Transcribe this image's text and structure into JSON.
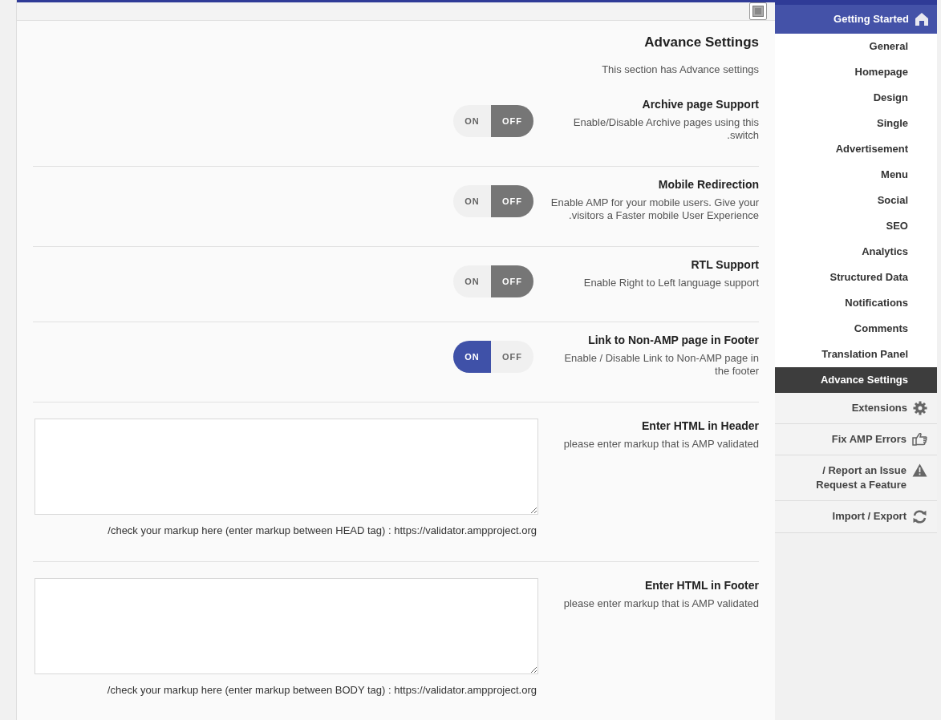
{
  "section": {
    "title": "Advance Settings",
    "description": "This section has Advance settings"
  },
  "settings": [
    {
      "kind": "toggle",
      "title": "Archive page Support",
      "description": "Enable/Disable Archive pages using this\n.switch",
      "on_label": "ON",
      "off_label": "OFF",
      "on": false
    },
    {
      "kind": "toggle",
      "title": "Mobile Redirection",
      "description": "Enable AMP for your mobile users. Give your\n.visitors a Faster mobile User Experience",
      "on_label": "ON",
      "off_label": "OFF",
      "on": false
    },
    {
      "kind": "toggle",
      "title": "RTL Support",
      "description": "Enable Right to Left language support",
      "on_label": "ON",
      "off_label": "OFF",
      "on": false
    },
    {
      "kind": "toggle",
      "title": "Link to Non-AMP page in Footer",
      "description": "Enable / Disable Link to Non-AMP page in\nthe footer",
      "on_label": "ON",
      "off_label": "OFF",
      "on": true
    },
    {
      "kind": "textarea",
      "title": "Enter HTML in Header",
      "description": "please enter markup that is AMP validated",
      "note": "/check your markup here (enter markup between HEAD tag) : https://validator.ampproject.org"
    },
    {
      "kind": "textarea",
      "title": "Enter HTML in Footer",
      "description": "please enter markup that is AMP validated",
      "note": "/check your markup here (enter markup between BODY tag) : https://validator.ampproject.org"
    }
  ],
  "sidebar": {
    "header": "Getting Started",
    "items": [
      {
        "label": "General",
        "selected": false
      },
      {
        "label": "Homepage",
        "selected": false
      },
      {
        "label": "Design",
        "selected": false
      },
      {
        "label": "Single",
        "selected": false
      },
      {
        "label": "Advertisement",
        "selected": false
      },
      {
        "label": "Menu",
        "selected": false
      },
      {
        "label": "Social",
        "selected": false
      },
      {
        "label": "SEO",
        "selected": false
      },
      {
        "label": "Analytics",
        "selected": false
      },
      {
        "label": "Structured Data",
        "selected": false
      },
      {
        "label": "Notifications",
        "selected": false
      },
      {
        "label": "Comments",
        "selected": false
      },
      {
        "label": "Translation Panel",
        "selected": false
      },
      {
        "label": "Advance Settings",
        "selected": true
      }
    ],
    "tools": [
      {
        "label": "Extensions"
      },
      {
        "label": "Fix AMP Errors"
      },
      {
        "label": "/ Report an Issue\nRequest a Feature"
      },
      {
        "label": "Import / Export"
      }
    ]
  }
}
